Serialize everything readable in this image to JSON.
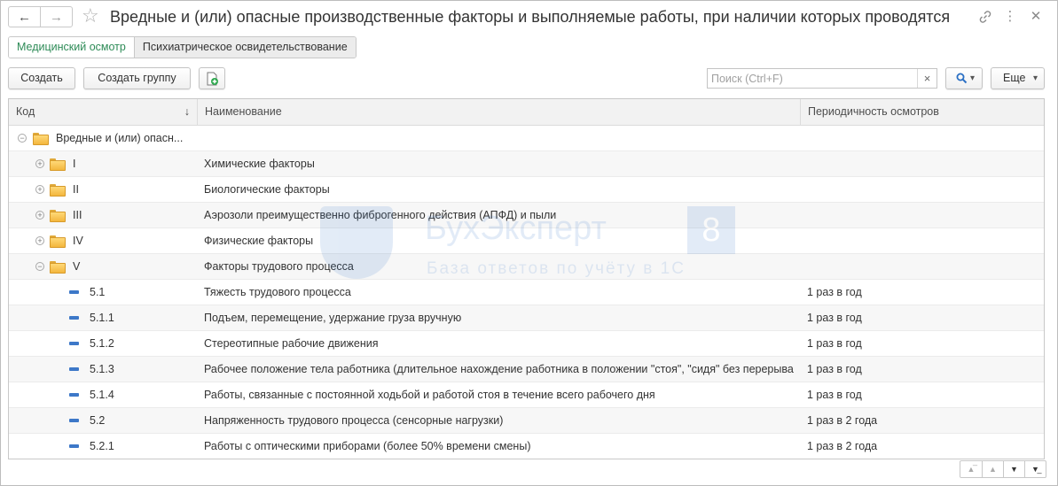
{
  "window": {
    "title": "Вредные и (или) опасные производственные факторы и выполняемые работы, при наличии которых проводятся",
    "back_icon": "arrow-left-icon",
    "forward_icon": "arrow-right-icon",
    "favorite_icon": "star-icon",
    "link_icon": "link-icon",
    "more_icon": "more-vertical-icon",
    "close_icon": "close-icon"
  },
  "tabs": [
    {
      "label": "Медицинский осмотр",
      "active": true
    },
    {
      "label": "Психиатрическое освидетельствование",
      "active": false
    }
  ],
  "toolbar": {
    "create_label": "Создать",
    "create_group_label": "Создать группу",
    "search_placeholder": "Поиск (Ctrl+F)",
    "search_value": "",
    "clear_glyph": "×",
    "more_label": "Еще",
    "dropdown_glyph": "▾"
  },
  "table": {
    "columns": {
      "code": "Код",
      "name": "Наименование",
      "periodicity": "Периодичность осмотров"
    },
    "sort_glyph": "↓",
    "rows": [
      {
        "code": "Вредные и (или) опасн...",
        "name": "",
        "periodicity": "",
        "kind": "group",
        "level": 0,
        "expanded": true
      },
      {
        "code": "I",
        "name": "Химические факторы",
        "periodicity": "",
        "kind": "group",
        "level": 1,
        "expanded": false
      },
      {
        "code": "II",
        "name": "Биологические факторы",
        "periodicity": "",
        "kind": "group",
        "level": 1,
        "expanded": false
      },
      {
        "code": "III",
        "name": "Аэрозоли преимущественно фиброгенного действия (АПФД) и пыли",
        "periodicity": "",
        "kind": "group",
        "level": 1,
        "expanded": false
      },
      {
        "code": "IV",
        "name": "Физические факторы",
        "periodicity": "",
        "kind": "group",
        "level": 1,
        "expanded": false
      },
      {
        "code": "V",
        "name": "Факторы трудового процесса",
        "periodicity": "",
        "kind": "group",
        "level": 1,
        "expanded": true
      },
      {
        "code": "5.1",
        "name": "Тяжесть трудового процесса",
        "periodicity": "1 раз в год",
        "kind": "item",
        "level": 2
      },
      {
        "code": "5.1.1",
        "name": "Подъем, перемещение, удержание груза вручную",
        "periodicity": "1 раз в год",
        "kind": "item",
        "level": 2
      },
      {
        "code": "5.1.2",
        "name": "Стереотипные рабочие движения",
        "periodicity": "1 раз в год",
        "kind": "item",
        "level": 2
      },
      {
        "code": "5.1.3",
        "name": "Рабочее положение тела работника (длительное нахождение работника в положении \"стоя\", \"сидя\" без перерыва",
        "periodicity": "1 раз в год",
        "kind": "item",
        "level": 2
      },
      {
        "code": "5.1.4",
        "name": "Работы, связанные с постоянной ходьбой и работой стоя в течение всего рабочего дня",
        "periodicity": "1 раз в год",
        "kind": "item",
        "level": 2
      },
      {
        "code": "5.2",
        "name": "Напряженность трудового процесса (сенсорные нагрузки)",
        "periodicity": "1 раз в 2 года",
        "kind": "item",
        "level": 2
      },
      {
        "code": "5.2.1",
        "name": "Работы с оптическими приборами (более 50% времени смены)",
        "periodicity": "1 раз в 2 года",
        "kind": "item",
        "level": 2
      }
    ]
  },
  "watermark": {
    "name": "БухЭксперт",
    "number": "8",
    "subtitle": "База ответов по учёту в 1С"
  },
  "pager": {
    "first_icon": "to-first-icon",
    "prev_icon": "page-up-icon",
    "next_icon": "page-down-icon",
    "last_icon": "to-last-icon"
  }
}
